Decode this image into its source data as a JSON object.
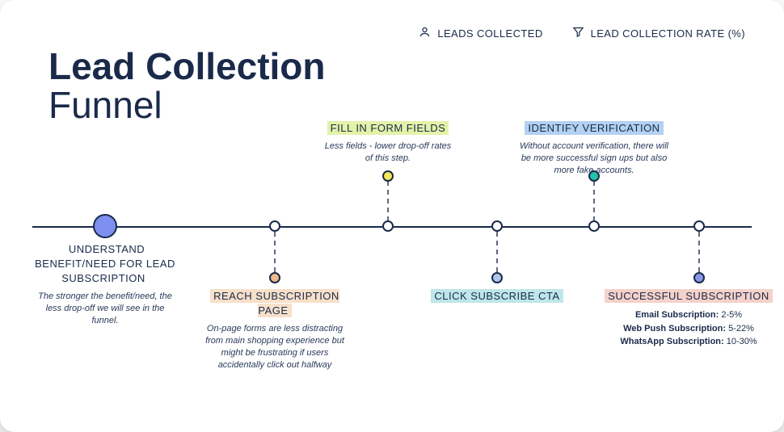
{
  "title": {
    "line1": "Lead Collection",
    "line2": "Funnel"
  },
  "legend": {
    "leads": "LEADS COLLECTED",
    "rate": "LEAD COLLECTION RATE (%)"
  },
  "steps": {
    "s1": {
      "title": "UNDERSTAND BENEFIT/NEED FOR LEAD SUBSCRIPTION",
      "desc": "The stronger the benefit/need, the less drop-off we will see in the funnel."
    },
    "s2": {
      "title": "REACH SUBSCRIPTION PAGE",
      "desc": "On-page forms are less distracting from main shopping experience but might be frustrating if users accidentally click out halfway"
    },
    "s3": {
      "title": "FILL IN FORM FIELDS",
      "desc": "Less fields - lower drop-off rates of this step."
    },
    "s4": {
      "title": "CLICK SUBSCRIBE CTA"
    },
    "s5": {
      "title": "IDENTIFY VERIFICATION",
      "desc": "Without account verification, there will be more successful sign ups but also more fake accounts."
    },
    "s6": {
      "title": "SUCCESSFUL SUBSCRIPTION",
      "bullets": [
        {
          "k": "Email Subscription:",
          "v": "2-5%"
        },
        {
          "k": "Web Push Subscription:",
          "v": "5-22%"
        },
        {
          "k": "WhatsApp Subscription:",
          "v": "10-30%"
        }
      ]
    }
  },
  "colors": {
    "s2_hl": "#f7e0c9",
    "s2_dot": "#f2b98f",
    "s3_hl": "#e3f2a8",
    "s3_dot": "#f5e85a",
    "s4_hl": "#bfe6e9",
    "s4_dot": "#b0c6e8",
    "s5_hl": "#b3d1f0",
    "s5_dot": "#24c1a8",
    "s6_hl": "#f4d1ca",
    "s6_dot": "#8c96e8"
  }
}
